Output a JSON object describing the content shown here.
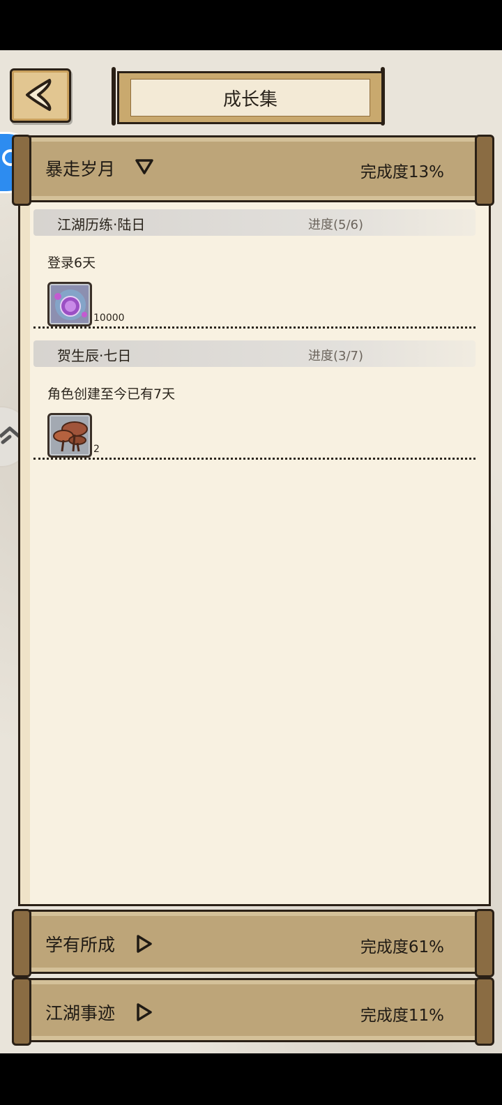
{
  "header": {
    "title": "成长集"
  },
  "sections": [
    {
      "title": "暴走岁月",
      "progress": "完成度13%",
      "expanded": true,
      "tasks": [
        {
          "name": "江湖历练·陆日",
          "progress": "进度(5/6)",
          "desc": "登录6天",
          "reward_icon": "purple-orb-icon",
          "reward_count": "10000"
        },
        {
          "name": "贺生辰·七日",
          "progress": "进度(3/7)",
          "desc": "角色创建至今已有7天",
          "reward_icon": "lingzhi-mushroom-icon",
          "reward_count": "2"
        }
      ]
    },
    {
      "title": "学有所成",
      "progress": "完成度61%",
      "expanded": false
    },
    {
      "title": "江湖事迹",
      "progress": "完成度11%",
      "expanded": false
    }
  ],
  "colors": {
    "panel_header": "#bda579",
    "paper": "#f8f1e1",
    "outline": "#2a2016",
    "float_search": "#2d8cf0"
  }
}
